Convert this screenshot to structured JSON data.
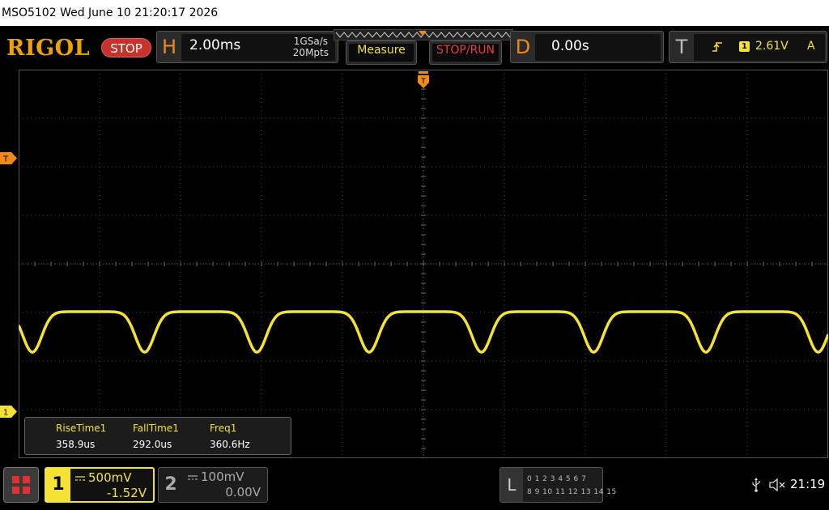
{
  "titlebar": {
    "text": "MSO5102  Wed June 10 21:20:17 2026"
  },
  "brand": {
    "logo": "RIGOL",
    "status_button": "STOP"
  },
  "horizontal": {
    "letter": "H",
    "timebase": "2.00ms",
    "sample_rate": "1GSa/s",
    "memory_depth": "20Mpts"
  },
  "buttons": {
    "measure": "Measure",
    "stop_run": "STOP/RUN"
  },
  "delay": {
    "letter": "D",
    "value": "0.00s"
  },
  "trigger": {
    "letter": "T",
    "edge_icon": "rising-edge-icon",
    "channel": "1",
    "level": "2.61V",
    "mode": "A"
  },
  "markers": {
    "trigger_level_label": "T",
    "channel1_ground_label": "1"
  },
  "measurements": [
    {
      "name": "RiseTime1",
      "value": "358.9us"
    },
    {
      "name": "FallTime1",
      "value": "292.0us"
    },
    {
      "name": "Freq1",
      "value": "360.6Hz"
    }
  ],
  "channels": [
    {
      "number": "1",
      "scale": "500mV",
      "offset": "-1.52V",
      "color": "#f5e232",
      "active": true
    },
    {
      "number": "2",
      "scale": "100mV",
      "offset": "0.00V",
      "color": "#aaaaaa",
      "active": false
    }
  ],
  "logic": {
    "letter": "L",
    "row1": "0 1 2 3   4 5 6 7",
    "row2": "8 9 10 11 12 13 14 15"
  },
  "status": {
    "clock": "21:19"
  },
  "colors": {
    "accent_orange": "#f08a18",
    "trace_yellow": "#f5e232",
    "stop_red": "#c8322b"
  }
}
